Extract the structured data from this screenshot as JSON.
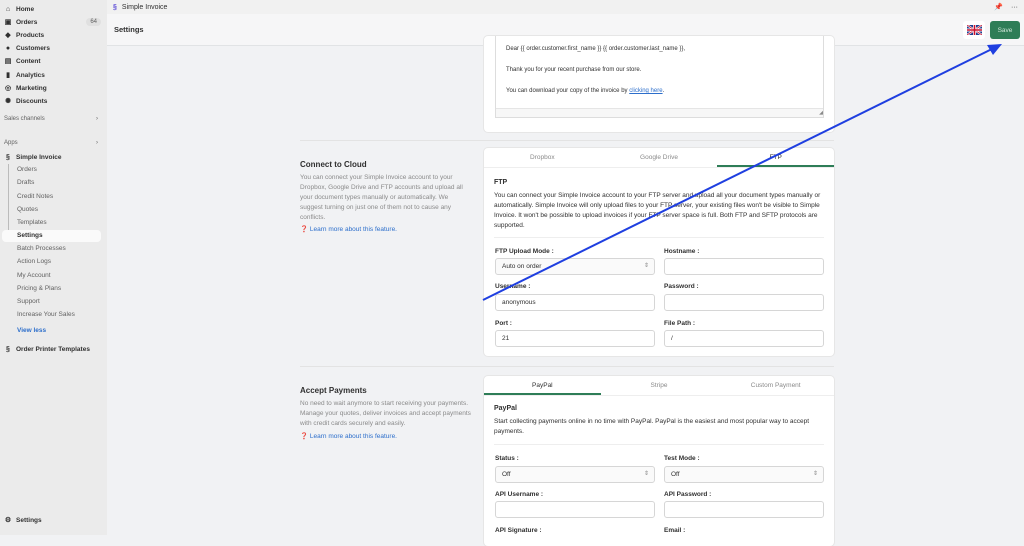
{
  "sidebar": {
    "main": [
      {
        "label": "Home",
        "icon": "home-icon"
      },
      {
        "label": "Orders",
        "icon": "orders-icon",
        "badge": "64"
      },
      {
        "label": "Products",
        "icon": "tag-icon"
      },
      {
        "label": "Customers",
        "icon": "person-icon"
      },
      {
        "label": "Content",
        "icon": "content-icon"
      },
      {
        "label": "Analytics",
        "icon": "chart-icon"
      },
      {
        "label": "Marketing",
        "icon": "target-icon"
      },
      {
        "label": "Discounts",
        "icon": "discount-icon"
      }
    ],
    "sales_channels": "Sales channels",
    "apps": "Apps",
    "app_name": "Simple Invoice",
    "app_items": [
      "Orders",
      "Drafts",
      "Credit Notes",
      "Quotes",
      "Templates",
      "Settings",
      "Batch Processes",
      "Action Logs",
      "My Account",
      "Pricing & Plans",
      "Support",
      "Increase Your Sales"
    ],
    "view_less": "View less",
    "order_printer": "Order Printer Templates",
    "settings": "Settings"
  },
  "topbar": {
    "title": "Simple Invoice"
  },
  "header": {
    "title": "Settings",
    "save": "Save",
    "flag": "uk-flag-icon"
  },
  "email": {
    "line1": "Dear {{ order.customer.first_name }} {{ order.customer.last_name }},",
    "line2": "Thank you for your recent purchase from our store.",
    "line3": "You can download your copy of the invoice by ",
    "link": "clicking here",
    "end": "."
  },
  "cloud": {
    "title": "Connect to Cloud",
    "desc": "You can connect your Simple Invoice account to your Dropbox, Google Drive and FTP accounts and upload all your document types manually or automatically. We suggest turning on just one of them not to cause any conflicts.",
    "link": "Learn more about this feature.",
    "tabs": [
      "Dropbox",
      "Google Drive",
      "FTP"
    ],
    "heading": "FTP",
    "text": "You can connect your Simple Invoice account to your FTP server and upload all your document types manually or automatically. Simple Invoice will only upload files to your FTP server, your existing files won't be visible to Simple Invoice. It won't be possible to upload invoices if your FTP server space is full. Both FTP and SFTP protocols are supported.",
    "fields": {
      "mode_label": "FTP Upload Mode :",
      "mode": "Auto on order",
      "host_label": "Hostname :",
      "host": "",
      "user_label": "Username :",
      "user": "anonymous",
      "pass_label": "Password :",
      "pass": "",
      "port_label": "Port :",
      "port": "21",
      "path_label": "File Path :",
      "path": "/"
    }
  },
  "payments": {
    "title": "Accept Payments",
    "desc": "No need to wait anymore to start receiving your payments. Manage your quotes, deliver invoices and accept payments with credit cards securely and easily.",
    "link": "Learn more about this feature.",
    "tabs": [
      "PayPal",
      "Stripe",
      "Custom Payment"
    ],
    "heading": "PayPal",
    "text": "Start collecting payments online in no time with PayPal. PayPal is the easiest and most popular way to accept payments.",
    "fields": {
      "status_label": "Status :",
      "status": "Off",
      "test_label": "Test Mode :",
      "test": "Off",
      "apiuser_label": "API Username :",
      "apipass_label": "API Password :",
      "apisig_label": "API Signature :",
      "email_label": "Email :"
    }
  },
  "colors": {
    "accent": "#2e7d57",
    "link": "#2c6ecb",
    "annotation": "#1f3fe0"
  }
}
